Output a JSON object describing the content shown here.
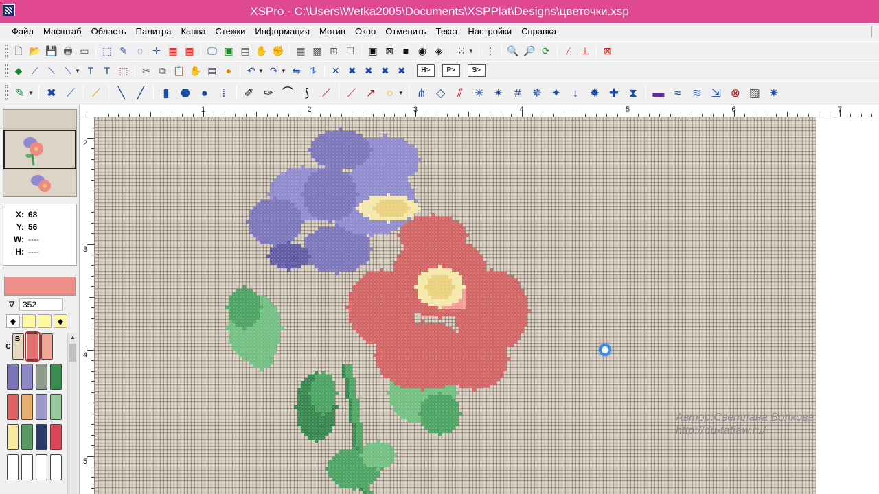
{
  "window": {
    "title": "XSPro - C:\\Users\\Wetka2005\\Documents\\XSPPlat\\Designs\\цветочки.xsp"
  },
  "menu": [
    "Файл",
    "Масштаб",
    "Область",
    "Палитра",
    "Канва",
    "Стежки",
    "Информация",
    "Мотив",
    "Окно",
    "Отменить",
    "Текст",
    "Настройки",
    "Справка"
  ],
  "toolbar_icons": {
    "row1": [
      "new-file-icon",
      "open-folder-icon",
      "save-icon",
      "print-icon",
      "print-preview-icon",
      "select-rect-icon",
      "select-freehand-icon",
      "lasso-icon",
      "crosshair-icon",
      "import-icon",
      "export-icon",
      "monitor-icon",
      "picture-icon",
      "magic-icon",
      "pan-hand-icon",
      "grab-hand-icon",
      "grid-fine-icon",
      "grid-medium-icon",
      "grid-coarse-icon",
      "blank-grid-icon",
      "view-full-icon",
      "view-stitch-icon",
      "view-block-icon",
      "view-color-icon",
      "view-symbol-icon",
      "grid-options-icon",
      "ruler-icon",
      "zoom-in-icon",
      "zoom-out-icon",
      "zoom-fit-icon",
      "picker-icon",
      "picker-replace-icon",
      "clear-format-icon"
    ],
    "row2": [
      "fill-icon",
      "brush-icon",
      "wand-icon",
      "wand-options-icon",
      "text-tool-icon",
      "text-style-icon",
      "dotted-rect-icon",
      "cut-icon",
      "copy-icon",
      "paste-icon",
      "paste-special-icon",
      "clipboard-icon",
      "palette-icon",
      "undo-icon",
      "redo-icon",
      "mirror-h-icon",
      "mirror-v-icon",
      "cross-stitch-icon",
      "cross-a-icon",
      "cross-b-icon",
      "cross-c-icon",
      "cross-d-icon"
    ],
    "row3": [
      "pencil-icon",
      "full-cross-icon",
      "half-cross-icon",
      "quarter-stitch-icon",
      "backstitch-icon",
      "long-stitch-icon",
      "bead-icon",
      "french-knot-icon",
      "dot-icon",
      "special-icon",
      "pen-icon",
      "pen-curve-icon",
      "arc-icon",
      "bezier-icon",
      "marker-icon",
      "line-icon",
      "curve-icon",
      "circle-icon",
      "fill-pattern-icon",
      "pattern-a-icon",
      "pattern-b-icon",
      "star-stitch-icon",
      "satin-icon",
      "hash-stitch-icon",
      "diamond-stitch-icon",
      "arrow-stitch-icon",
      "down-stitch-icon",
      "block-stitch-icon",
      "small-star-icon",
      "bow-stitch-icon",
      "zigzag-a-icon",
      "zigzag-b-icon",
      "zigzag-c-icon",
      "corner-icon",
      "x-pattern-icon",
      "shade-icon",
      "spark-icon"
    ]
  },
  "toolbar_text_buttons": {
    "h_button": "H>",
    "p_button": "P>",
    "s_button": "S>"
  },
  "coords": {
    "x_label": "X:",
    "x_value": "68",
    "y_label": "Y:",
    "y_value": "56",
    "w_label": "W:",
    "w_value": "----",
    "h_label": "H:",
    "h_value": "----"
  },
  "palette": {
    "current_color": "#ef8f8a",
    "filter_value": "352",
    "row_label_c": "C",
    "row_label_b": "B",
    "swatches": [
      [
        "#e6d8c0",
        "#e57070",
        "#f2a898"
      ],
      [
        "#7a74b8",
        "#8e88c8",
        "#8e9a8a",
        "#3a8a52"
      ],
      [
        "#e06262",
        "#e8b070",
        "#9a98c8",
        "#98c8a0"
      ],
      [
        "#f8e8a0",
        "#5a9a62",
        "#2a3a6a",
        "#d8485a"
      ],
      [
        "#ffffff",
        "#ffffff",
        "#ffffff",
        "#ffffff"
      ]
    ]
  },
  "ruler": {
    "top_labels": [
      "1",
      "2",
      "3",
      "4",
      "5",
      "6",
      "7"
    ],
    "left_labels": [
      "2",
      "3",
      "4",
      "5"
    ]
  },
  "canvas": {
    "fabric_color": "#c9bfb3",
    "watermark_line1": "Автор:Светлана Волкова",
    "watermark_line2": "http://du-tatiaw.ru/"
  }
}
